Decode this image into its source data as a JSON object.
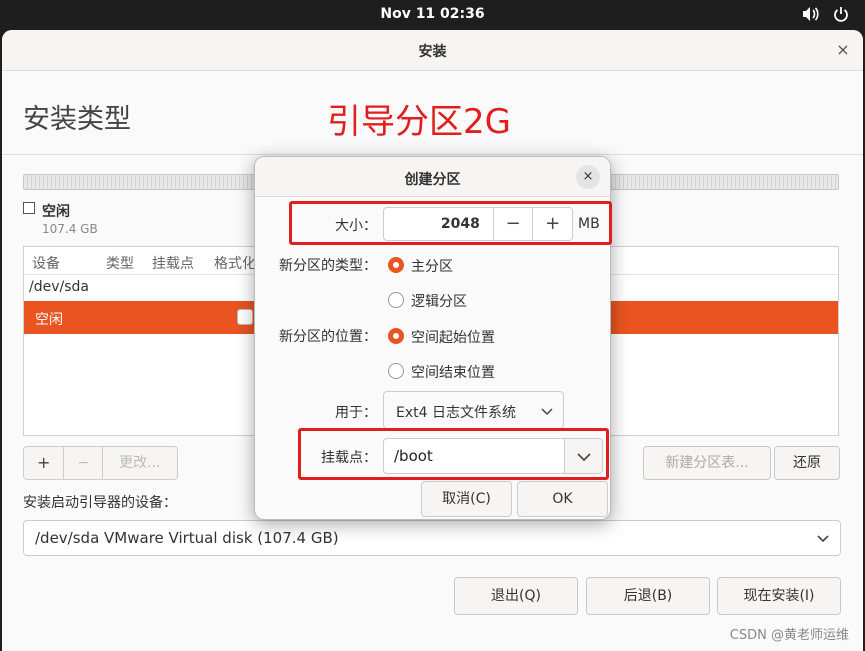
{
  "topbar": {
    "clock": "Nov 11  02:36",
    "volume_icon": "volume-icon",
    "power_icon": "power-icon"
  },
  "window": {
    "title": "安装",
    "close_glyph": "×"
  },
  "page": {
    "title": "安装类型",
    "annotation": "引导分区2G"
  },
  "disk": {
    "legend_name": "空闲",
    "legend_size": "107.4 GB"
  },
  "table": {
    "columns": [
      "设备",
      "类型",
      "挂载点",
      "格式化"
    ],
    "device_row": "/dev/sda",
    "selected_row": {
      "label": "空闲"
    }
  },
  "table_toolbar": {
    "add": "+",
    "remove": "−",
    "change": "更改..."
  },
  "actions": {
    "new_table": "新建分区表...",
    "revert": "还原"
  },
  "bootloader": {
    "label": "安装启动引导器的设备：",
    "value": "/dev/sda VMware Virtual disk (107.4 GB)"
  },
  "footer": {
    "quit": "退出(Q)",
    "back": "后退(B)",
    "install_now": "现在安装(I)"
  },
  "watermark": "CSDN @黄老师运维",
  "dialog": {
    "title": "创建分区",
    "close_glyph": "×",
    "size_label": "大小：",
    "size_value": "2048",
    "size_minus": "−",
    "size_plus": "+",
    "size_unit": "MB",
    "type_label": "新分区的类型：",
    "type_primary": "主分区",
    "type_logical": "逻辑分区",
    "type_selected": "primary",
    "location_label": "新分区的位置：",
    "location_start": "空间起始位置",
    "location_end": "空间结束位置",
    "location_selected": "start",
    "use_label": "用于：",
    "use_value": "Ext4 日志文件系统",
    "mount_label": "挂载点：",
    "mount_value": "/boot",
    "cancel": "取消(C)",
    "ok": "OK"
  },
  "colors": {
    "accent": "#e95420",
    "annotation_red": "#e01e1e"
  }
}
